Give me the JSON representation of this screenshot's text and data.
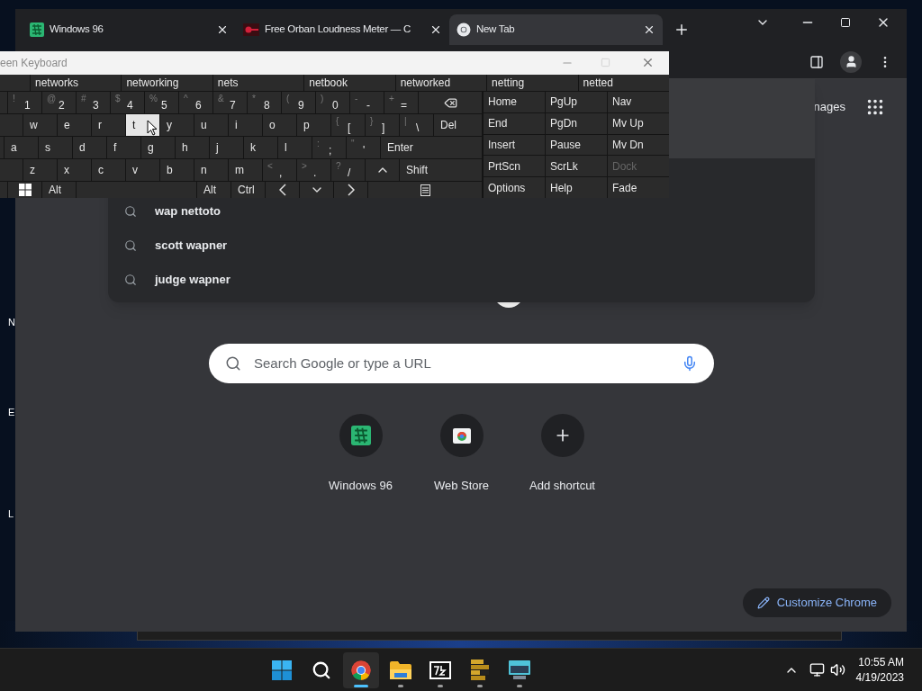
{
  "chrome": {
    "tabs": [
      {
        "title": "Windows 96",
        "selected": false,
        "kind": "grid"
      },
      {
        "title": "Free Orban Loudness Meter — C",
        "selected": false,
        "kind": "meter"
      },
      {
        "title": "New Tab",
        "selected": true,
        "kind": "ring"
      }
    ],
    "images_link": "nages",
    "suggestions": [
      "wap nettoto",
      "scott wapner",
      "judge wapner"
    ],
    "search": {
      "placeholder": "Search Google or type a URL"
    },
    "shortcuts": [
      {
        "label": "Windows 96",
        "kind": "grid"
      },
      {
        "label": "Web Store",
        "kind": "store"
      },
      {
        "label": "Add shortcut",
        "kind": "add"
      }
    ],
    "customize": "Customize Chrome"
  },
  "keyboard": {
    "title": "een Keyboard",
    "words": [
      "networks",
      "networking",
      "nets",
      "netbook",
      "networked",
      "netting",
      "netted"
    ],
    "rows": [
      [
        {
          "kind": "char",
          "shift": "!",
          "main": "1",
          "pressed": false
        },
        {
          "kind": "char",
          "shift": "@",
          "main": "2",
          "pressed": false
        },
        {
          "kind": "char",
          "shift": "#",
          "main": "3",
          "pressed": false
        },
        {
          "kind": "char",
          "shift": "$",
          "main": "4",
          "pressed": false
        },
        {
          "kind": "char",
          "shift": "%",
          "main": "5",
          "pressed": false
        },
        {
          "kind": "char",
          "shift": "^",
          "main": "6",
          "pressed": false
        },
        {
          "kind": "char",
          "shift": "&",
          "main": "7",
          "pressed": false
        },
        {
          "kind": "char",
          "shift": "*",
          "main": "8",
          "pressed": false
        },
        {
          "kind": "char",
          "shift": "(",
          "main": "9",
          "pressed": false
        },
        {
          "kind": "char",
          "shift": ")",
          "main": "0",
          "pressed": false
        },
        {
          "kind": "char",
          "shift": "-",
          "main": "-",
          "pressed": false
        },
        {
          "kind": "char",
          "shift": "+",
          "main": "=",
          "pressed": false
        },
        {
          "kind": "backspace",
          "pressed": false
        }
      ],
      [
        {
          "kind": "char",
          "main": "w",
          "pressed": false
        },
        {
          "kind": "char",
          "main": "e",
          "pressed": false
        },
        {
          "kind": "char",
          "main": "r",
          "pressed": false
        },
        {
          "kind": "char",
          "main": "t",
          "pressed": true
        },
        {
          "kind": "char",
          "main": "y",
          "pressed": false
        },
        {
          "kind": "char",
          "main": "u",
          "pressed": false
        },
        {
          "kind": "char",
          "main": "i",
          "pressed": false
        },
        {
          "kind": "char",
          "main": "o",
          "pressed": false
        },
        {
          "kind": "char",
          "main": "p",
          "pressed": false
        },
        {
          "kind": "char",
          "shift": "{",
          "main": "[",
          "pressed": false
        },
        {
          "kind": "char",
          "shift": "}",
          "main": "]",
          "pressed": false
        },
        {
          "kind": "char",
          "shift": "|",
          "main": "\\",
          "pressed": false
        },
        {
          "kind": "label",
          "main": "Del",
          "pressed": false
        }
      ],
      [
        {
          "kind": "char",
          "main": "a",
          "pressed": false
        },
        {
          "kind": "char",
          "main": "s",
          "pressed": false
        },
        {
          "kind": "char",
          "main": "d",
          "pressed": false
        },
        {
          "kind": "char",
          "main": "f",
          "pressed": false
        },
        {
          "kind": "char",
          "main": "g",
          "pressed": false
        },
        {
          "kind": "char",
          "main": "h",
          "pressed": false
        },
        {
          "kind": "char",
          "main": "j",
          "pressed": false
        },
        {
          "kind": "char",
          "main": "k",
          "pressed": false
        },
        {
          "kind": "char",
          "main": "l",
          "pressed": false
        },
        {
          "kind": "char",
          "shift": ":",
          "main": ";",
          "pressed": false
        },
        {
          "kind": "char",
          "shift": "\"",
          "main": "'",
          "pressed": false
        },
        {
          "kind": "label",
          "main": "Enter",
          "pressed": false
        }
      ],
      [
        {
          "kind": "char",
          "main": "z",
          "pressed": false
        },
        {
          "kind": "char",
          "main": "x",
          "pressed": false
        },
        {
          "kind": "char",
          "main": "c",
          "pressed": false
        },
        {
          "kind": "char",
          "main": "v",
          "pressed": false
        },
        {
          "kind": "char",
          "main": "b",
          "pressed": false
        },
        {
          "kind": "char",
          "main": "n",
          "pressed": false
        },
        {
          "kind": "char",
          "main": "m",
          "pressed": false
        },
        {
          "kind": "char",
          "shift": "<",
          "main": ",",
          "pressed": false
        },
        {
          "kind": "char",
          "shift": ">",
          "main": ".",
          "pressed": false
        },
        {
          "kind": "char",
          "shift": "?",
          "main": "/",
          "pressed": false
        },
        {
          "kind": "up",
          "pressed": false
        },
        {
          "kind": "label",
          "main": "Shift",
          "pressed": false
        }
      ],
      [
        {
          "kind": "windows",
          "pressed": false
        },
        {
          "kind": "char",
          "main": "Alt",
          "pressed": false
        },
        {
          "kind": "space",
          "pressed": false
        },
        {
          "kind": "char",
          "main": "Alt",
          "pressed": false
        },
        {
          "kind": "char",
          "main": "Ctrl",
          "pressed": false
        },
        {
          "kind": "left",
          "pressed": false
        },
        {
          "kind": "down",
          "pressed": false
        },
        {
          "kind": "right",
          "pressed": false
        },
        {
          "kind": "menu",
          "pressed": false
        }
      ]
    ],
    "side_keys": [
      [
        {
          "label": "Home",
          "disabled": false
        },
        {
          "label": "PgUp",
          "disabled": false
        },
        {
          "label": "Nav",
          "disabled": false
        }
      ],
      [
        {
          "label": "End",
          "disabled": false
        },
        {
          "label": "PgDn",
          "disabled": false
        },
        {
          "label": "Mv Up",
          "disabled": false
        }
      ],
      [
        {
          "label": "Insert",
          "disabled": false
        },
        {
          "label": "Pause",
          "disabled": false
        },
        {
          "label": "Mv Dn",
          "disabled": false
        }
      ],
      [
        {
          "label": "PrtScn",
          "disabled": false
        },
        {
          "label": "ScrLk",
          "disabled": false
        },
        {
          "label": "Dock",
          "disabled": true
        }
      ],
      [
        {
          "label": "Options",
          "disabled": false
        },
        {
          "label": "Help",
          "disabled": false
        },
        {
          "label": "Fade",
          "disabled": false
        }
      ]
    ]
  },
  "desktop": {
    "labels": [
      "N",
      "E",
      "L"
    ]
  },
  "taskbar": {
    "apps": [
      {
        "kind": "start",
        "selected": false,
        "running": false
      },
      {
        "kind": "search",
        "selected": false,
        "running": false
      },
      {
        "kind": "browser",
        "selected": true,
        "running": true
      },
      {
        "kind": "folder",
        "selected": false,
        "running": true
      },
      {
        "kind": "archive",
        "selected": false,
        "running": true
      },
      {
        "kind": "bars",
        "selected": false,
        "running": true
      },
      {
        "kind": "screen",
        "selected": false,
        "running": true
      }
    ],
    "time": "10:55 AM",
    "date": "4/19/2023"
  }
}
